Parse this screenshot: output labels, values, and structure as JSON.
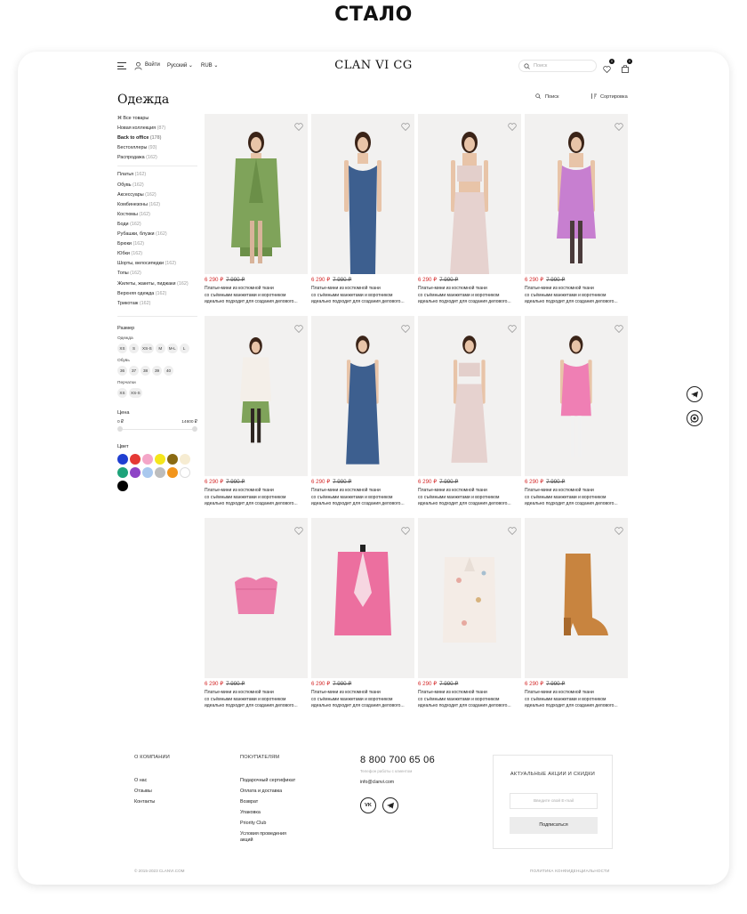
{
  "banner": {
    "title": "СТАЛО"
  },
  "header": {
    "login": "Войти",
    "language": "Русский ⌄",
    "currency": "RUB ⌄",
    "logo": "CLAN VI",
    "logo_mark": "CG",
    "search_placeholder": "Поиск",
    "wishlist_count": "0",
    "cart_count": "0"
  },
  "sidebar": {
    "title": "Одежда",
    "top_links": [
      {
        "label": "Все товары",
        "count": ""
      },
      {
        "label": "Новая коллекция",
        "count": "(87)"
      },
      {
        "label": "Back to office",
        "count": "(178)"
      },
      {
        "label": "Бестселлеры",
        "count": "(93)"
      },
      {
        "label": "Распродажа",
        "count": "(162)"
      }
    ],
    "categories": [
      {
        "label": "Платья",
        "count": "(162)"
      },
      {
        "label": "Обувь",
        "count": "(162)"
      },
      {
        "label": "Аксессуары",
        "count": "(162)"
      },
      {
        "label": "Комбинезоны",
        "count": "(162)"
      },
      {
        "label": "Костюмы",
        "count": "(162)"
      },
      {
        "label": "Боди",
        "count": "(162)"
      },
      {
        "label": "Рубашки, блузки",
        "count": "(162)"
      },
      {
        "label": "Брюки",
        "count": "(162)"
      },
      {
        "label": "Юбки",
        "count": "(162)"
      },
      {
        "label": "Шорты, велосипедки",
        "count": "(162)"
      },
      {
        "label": "Топы",
        "count": "(162)"
      },
      {
        "label": "Жилеты, жакеты, пиджаки",
        "count": "(162)"
      },
      {
        "label": "Верхняя одежда",
        "count": "(162)"
      },
      {
        "label": "Трикотаж",
        "count": "(162)"
      }
    ],
    "size_title": "Размер",
    "clothes_label": "Одежда",
    "clothes_sizes": [
      "XS",
      "S",
      "XS-S",
      "M",
      "M-L",
      "L"
    ],
    "shoes_label": "Обувь",
    "shoe_sizes": [
      "36",
      "37",
      "38",
      "39",
      "40"
    ],
    "gloves_label": "Перчатки",
    "glove_sizes": [
      "XS",
      "XS-S"
    ],
    "price_title": "Цена",
    "price_min": "0 ₽",
    "price_max": "14600 ₽",
    "color_title": "Цвет",
    "colors": [
      "#1f3fd1",
      "#e53935",
      "#f4a6c8",
      "#f5e61b",
      "#8a6a12",
      "#f6ecd2",
      "#1ea37a",
      "#8e44c6",
      "#a9c8ee",
      "#bdbdbd",
      "#f2951c",
      "#ffffff",
      "#000000"
    ]
  },
  "toolbar": {
    "search": "Поиск",
    "sort": "Сортировка"
  },
  "products": [
    {
      "price": "6 290 ₽",
      "old_price": "7 990 ₽",
      "desc": [
        "Платье-мини из костюмной ткани",
        "со съёмными манжетами и воротником",
        "идеально подходит для создания делового..."
      ],
      "art": "green-blazer"
    },
    {
      "price": "6 290 ₽",
      "old_price": "7 990 ₽",
      "desc": [
        "Платье-мини из костюмной ткани",
        "со съёмными манжетами и воротником",
        "идеально подходит для создания делового..."
      ],
      "art": "blue-corset-dress"
    },
    {
      "price": "6 290 ₽",
      "old_price": "7 990 ₽",
      "desc": [
        "Платье-мини из костюмной ткани",
        "со съёмными манжетами и воротником",
        "идеально подходит для создания делового..."
      ],
      "art": "satin-set"
    },
    {
      "price": "6 290 ₽",
      "old_price": "7 990 ₽",
      "desc": [
        "Платье-мини из костюмной ткани",
        "со съёмными манжетами и воротником",
        "идеально подходит для создания делового..."
      ],
      "art": "lilac-dress"
    },
    {
      "price": "6 290 ₽",
      "old_price": "7 990 ₽",
      "desc": [
        "Платье-мини из костюмной ткани",
        "со съёмными манжетами и воротником",
        "идеально подходит для создания делового..."
      ],
      "art": "blouse-green-skirt"
    },
    {
      "price": "6 290 ₽",
      "old_price": "7 990 ₽",
      "desc": [
        "Платье-мини из костюмной ткани",
        "со съёмными манжетами и воротником",
        "идеально подходит для создания делового..."
      ],
      "art": "blue-long-dress"
    },
    {
      "price": "6 290 ₽",
      "old_price": "7 990 ₽",
      "desc": [
        "Платье-мини из костюмной ткани",
        "со съёмными манжетами и воротником",
        "идеально подходит для создания делового..."
      ],
      "art": "satin-full"
    },
    {
      "price": "6 290 ₽",
      "old_price": "7 990 ₽",
      "desc": [
        "Платье-мини из костюмной ткани",
        "со съёмными манжетами и воротником",
        "идеально подходит для создания делового..."
      ],
      "art": "pink-dress"
    },
    {
      "price": "6 290 ₽",
      "old_price": "7 990 ₽",
      "desc": [
        "Платье-мини из костюмной ткани",
        "со съёмными манжетами и воротником",
        "идеально подходит для создания делового..."
      ],
      "art": "pink-bustier"
    },
    {
      "price": "6 290 ₽",
      "old_price": "7 990 ₽",
      "desc": [
        "Платье-мини из костюмной ткани",
        "со съёмными манжетами и воротником",
        "идеально подходит для создания делового..."
      ],
      "art": "pink-jacket"
    },
    {
      "price": "6 290 ₽",
      "old_price": "7 990 ₽",
      "desc": [
        "Платье-мини из костюмной ткани",
        "со съёмными манжетами и воротником",
        "идеально подходит для создания делового..."
      ],
      "art": "floral-blouse"
    },
    {
      "price": "6 290 ₽",
      "old_price": "7 990 ₽",
      "desc": [
        "Платье-мини из костюмной ткани",
        "со съёмными манжетами и воротником",
        "идеально подходит для создания делового..."
      ],
      "art": "boot"
    }
  ],
  "footer": {
    "company_title": "О КОМПАНИИ",
    "company_links": [
      "О нас",
      "Отзывы",
      "Контакты"
    ],
    "buyers_title": "ПОКУПАТЕЛЯМ",
    "buyers_links": [
      "Подарочный сертификат",
      "Оплата и доставка",
      "Возврат",
      "Упаковка",
      "Priority Club",
      "Условия проведения",
      "акций"
    ],
    "phone": "8 800 700 65 06",
    "hours": "Телефон работы с клиентом",
    "email": "info@clanvi.com",
    "vk": "VK",
    "promo_title": "АКТУАЛЬНЫЕ АКЦИИ И СКИДКИ",
    "email_placeholder": "Введите свой E-mail",
    "subscribe": "Подписаться",
    "copyright": "© 2015-2023 CLANVI.COM",
    "policy": "ПОЛИТИКА КОНФИДЕНЦИАЛЬНОСТИ"
  }
}
